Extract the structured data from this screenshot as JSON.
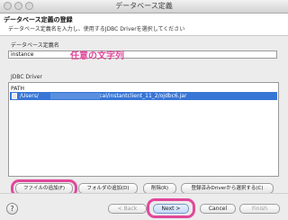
{
  "window": {
    "title": "データベース定義"
  },
  "header": {
    "title": "データベース定義の登録",
    "description": "データベース定義名を入力し、使用するJDBC Driverを選択してください"
  },
  "form": {
    "db_name_label": "データベース定義名",
    "db_name_value": "instance",
    "annotation": "任意の文字列"
  },
  "jdbc": {
    "section_label": "JDBC Driver",
    "column_header": "PATH",
    "rows": [
      {
        "path_prefix": "/Users/",
        "path_suffix": "/local/instantclient_11_2/ojdbc6.jar"
      }
    ]
  },
  "driver_buttons": {
    "add_file": "ファイルの追加(F)",
    "add_folder": "フォルダの追加(D)",
    "remove": "削除(R)",
    "select_registered": "登録済みDriverから選択する(C)"
  },
  "footer": {
    "help": "?",
    "back": "< Back",
    "next": "Next >",
    "cancel": "Cancel",
    "finish": "Finish"
  },
  "colors": {
    "highlight": "#e2479a",
    "selection": "#3876d6"
  }
}
